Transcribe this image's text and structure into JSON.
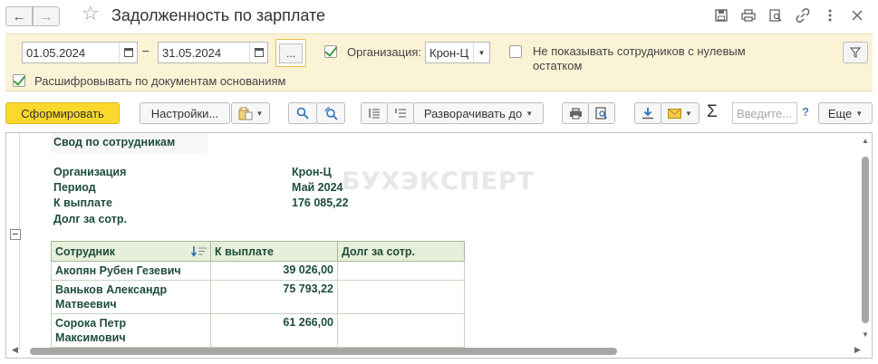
{
  "window": {
    "title": "Задолженность по зарплате"
  },
  "filters": {
    "date_from": "01.05.2024",
    "date_to": "31.05.2024",
    "dash": "–",
    "dots_label": "...",
    "org_label": "Организация:",
    "org_value": "Крон-Ц",
    "hide_zero_label_1": "Не показывать сотрудников с нулевым",
    "hide_zero_label_2": "остатком",
    "decode_label": "Расшифровывать по документам основаниям"
  },
  "toolbar": {
    "generate_label": "Сформировать",
    "settings_label": "Настройки...",
    "expand_label": "Разворачивать до",
    "search_placeholder": "Введите...",
    "more_label": "Еще",
    "help_label": "?",
    "sigma": "Σ"
  },
  "report": {
    "heading": "Свод по сотрудникам",
    "watermark": "БУХЭКСПЕРТ",
    "summary": [
      {
        "label": "Организация",
        "value": "Крон-Ц"
      },
      {
        "label": "Период",
        "value": "Май 2024"
      },
      {
        "label": "К выплате",
        "value": "176 085,22"
      },
      {
        "label": "Долг за сотр.",
        "value": ""
      }
    ],
    "columns": [
      "Сотрудник",
      "К выплате",
      "Долг за сотр."
    ],
    "rows": [
      {
        "name_1": "Акопян Рубен Гезевич",
        "name_2": "",
        "pay": "39 026,00",
        "debt": ""
      },
      {
        "name_1": "Ваньков Александр",
        "name_2": "Матвеевич",
        "pay": "75 793,22",
        "debt": ""
      },
      {
        "name_1": "Сорока Петр",
        "name_2": "Максимович",
        "pay": "61 266,00",
        "debt": ""
      }
    ]
  },
  "colors": {
    "primary_button": "#fbd92c",
    "filter_panel": "#fbf3d6",
    "table_header": "#e6efd9",
    "report_text": "#1d4d3a"
  }
}
